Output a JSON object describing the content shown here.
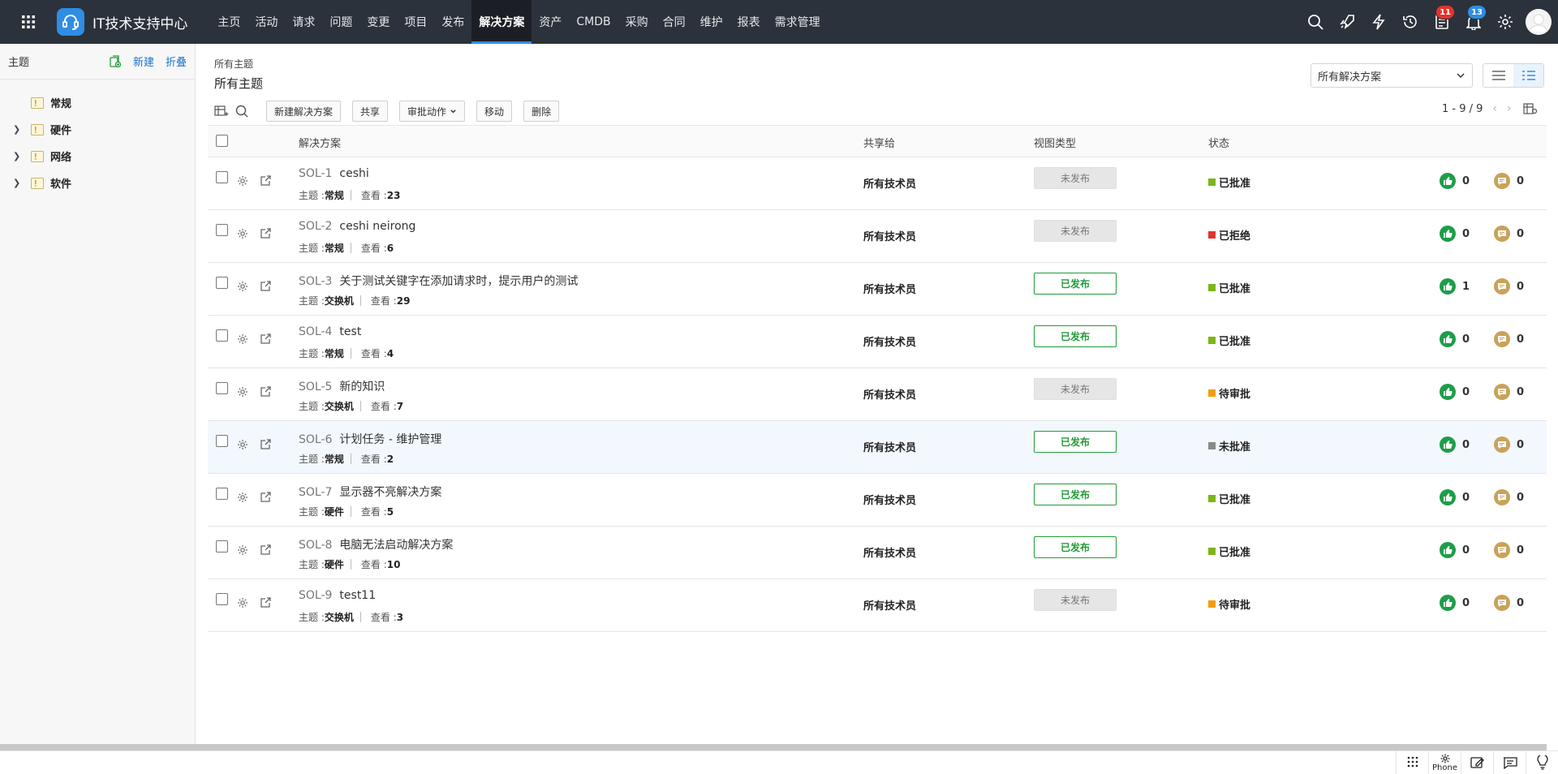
{
  "app": {
    "title": "IT技术支持中心",
    "nav": [
      "主页",
      "活动",
      "请求",
      "问题",
      "变更",
      "项目",
      "发布",
      "解决方案",
      "资产",
      "CMDB",
      "采购",
      "合同",
      "维护",
      "报表",
      "需求管理"
    ],
    "active_nav": "解决方案",
    "badges": {
      "tasks": "11",
      "notifications": "13"
    },
    "icons": [
      "apps-grid-icon",
      "search-icon",
      "rocket-icon",
      "lightning-icon",
      "history-icon",
      "tasks-icon",
      "bell-icon",
      "gear-icon"
    ]
  },
  "sidebar": {
    "title": "主题",
    "new_label": "新建",
    "collapse_label": "折叠",
    "items": [
      {
        "label": "常规",
        "expandable": false
      },
      {
        "label": "硬件",
        "expandable": true
      },
      {
        "label": "网络",
        "expandable": true
      },
      {
        "label": "软件",
        "expandable": true
      }
    ]
  },
  "main": {
    "breadcrumb": "所有主题",
    "title": "所有主题",
    "view_selector": "所有解决方案",
    "toolbar": {
      "new_solution": "新建解决方案",
      "share": "共享",
      "approval": "审批动作",
      "move": "移动",
      "delete": "删除"
    },
    "pagination": "1 - 9 / 9",
    "columns": {
      "solution": "解决方案",
      "shared_to": "共享给",
      "view_type": "视图类型",
      "status": "状态"
    },
    "meta_labels": {
      "topic": "主题 : ",
      "views": "查看 : "
    }
  },
  "rows": [
    {
      "id": "SOL-1",
      "title": "ceshi",
      "topic": "常规",
      "views": "23",
      "shared": "所有技术员",
      "view_type": "未发布",
      "published": false,
      "status": "已批准",
      "status_color": "#7cb518",
      "likes": "0",
      "comments": "0"
    },
    {
      "id": "SOL-2",
      "title": "ceshi neirong",
      "topic": "常规",
      "views": "6",
      "shared": "所有技术员",
      "view_type": "未发布",
      "published": false,
      "status": "已拒绝",
      "status_color": "#e5322d",
      "likes": "0",
      "comments": "0"
    },
    {
      "id": "SOL-3",
      "title": "关于测试关键字在添加请求时，提示用户的测试",
      "topic": "交换机",
      "views": "29",
      "shared": "所有技术员",
      "view_type": "已发布",
      "published": true,
      "status": "已批准",
      "status_color": "#7cb518",
      "likes": "1",
      "comments": "0"
    },
    {
      "id": "SOL-4",
      "title": "test",
      "topic": "常规",
      "views": "4",
      "shared": "所有技术员",
      "view_type": "已发布",
      "published": true,
      "status": "已批准",
      "status_color": "#7cb518",
      "likes": "0",
      "comments": "0"
    },
    {
      "id": "SOL-5",
      "title": "新的知识",
      "topic": "交换机",
      "views": "7",
      "shared": "所有技术员",
      "view_type": "未发布",
      "published": false,
      "status": "待审批",
      "status_color": "#f39c12",
      "likes": "0",
      "comments": "0"
    },
    {
      "id": "SOL-6",
      "title": "计划任务 - 维护管理",
      "topic": "常规",
      "views": "2",
      "shared": "所有技术员",
      "view_type": "已发布",
      "published": true,
      "status": "未批准",
      "status_color": "#8a8a8a",
      "likes": "0",
      "comments": "0",
      "highlight": true
    },
    {
      "id": "SOL-7",
      "title": "显示器不亮解决方案",
      "topic": "硬件",
      "views": "5",
      "shared": "所有技术员",
      "view_type": "已发布",
      "published": true,
      "status": "已批准",
      "status_color": "#7cb518",
      "likes": "0",
      "comments": "0"
    },
    {
      "id": "SOL-8",
      "title": "电脑无法启动解决方案",
      "topic": "硬件",
      "views": "10",
      "shared": "所有技术员",
      "view_type": "已发布",
      "published": true,
      "status": "已批准",
      "status_color": "#7cb518",
      "likes": "0",
      "comments": "0"
    },
    {
      "id": "SOL-9",
      "title": "test11",
      "topic": "交换机",
      "views": "3",
      "shared": "所有技术员",
      "view_type": "未发布",
      "published": false,
      "status": "待审批",
      "status_color": "#f39c12",
      "likes": "0",
      "comments": "0"
    }
  ],
  "colors": {
    "like_green": "#1e9d4a",
    "comment_gold": "#c9a25a",
    "published_green": "#239b37",
    "accent_blue": "#2f8de4"
  },
  "footer": {
    "phone_label": "Phone"
  }
}
